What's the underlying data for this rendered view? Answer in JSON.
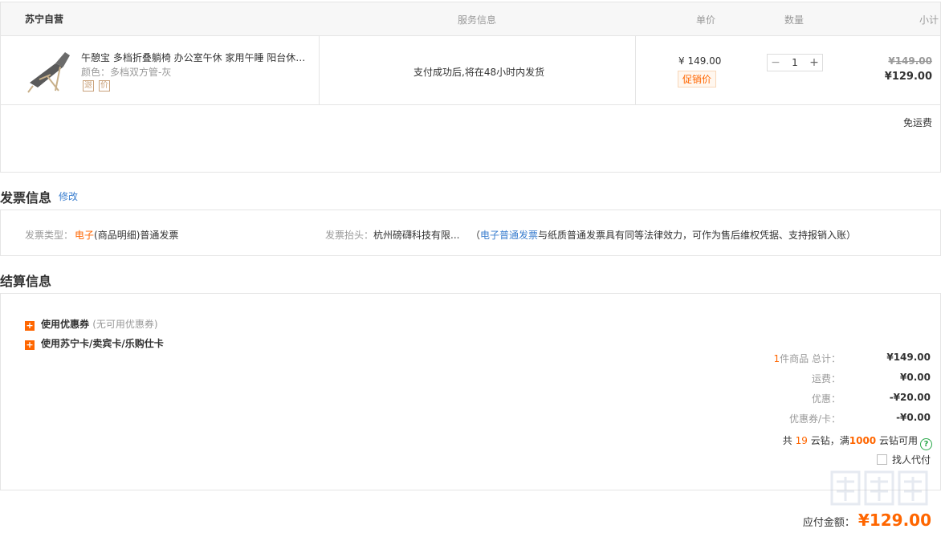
{
  "order": {
    "store_name": "苏宁自营",
    "headers": {
      "service": "服务信息",
      "price": "单价",
      "qty": "数量",
      "subtotal": "小计"
    },
    "item": {
      "title": "午憩宝 多档折叠躺椅 办公室午休 家用午睡 阳台休…",
      "color": "颜色：多档双方管-灰",
      "tags": [
        "退",
        "价"
      ],
      "service": "支付成功后,将在48小时内发货",
      "unit_price": "¥ 149.00",
      "promo_badge": "促销价",
      "qty_minus": "−",
      "qty_value": "1",
      "qty_plus": "+",
      "subtotal_old": "¥149.00",
      "subtotal_new": "¥129.00"
    },
    "shipping": "免运费"
  },
  "invoice": {
    "title": "发票信息",
    "edit_link": "修改",
    "type_label": "发票类型：",
    "type_value_highlight": "电子",
    "type_value_rest": "(商品明细)普通发票",
    "head_label": "发票抬头：",
    "head_value": "杭州磅礴科技有限...",
    "note_prefix": "（",
    "note_link": "电子普通发票",
    "note_rest": "与纸质普通发票具有同等法律效力，可作为售后维权凭据、支持报销入账）"
  },
  "settlement": {
    "title": "结算信息",
    "coupon_label": "使用优惠券",
    "coupon_hint": "(无可用优惠券)",
    "card_label": "使用苏宁卡/卖宾卡/乐购仕卡",
    "summary": {
      "count": "1",
      "count_suffix": "件商品 总计：",
      "total": "¥149.00",
      "freight_label": "运费：",
      "freight": "¥0.00",
      "discount_label": "优惠：",
      "discount": "-¥20.00",
      "coupon_card_label": "优惠券/卡：",
      "coupon_card": "-¥0.00"
    },
    "yunzuan": {
      "prefix": "共",
      "count": "19",
      "mid": "云钻，满",
      "threshold": "1000",
      "suffix": "云钻可用"
    },
    "proxy_pay_label": "找人代付"
  },
  "due": {
    "label": "应付金额：",
    "amount": "¥129.00"
  },
  "colors": {
    "accent": "#ff6600",
    "link": "#3a7ecf",
    "border": "#e5e5e5"
  },
  "icons": [
    "product-thumbnail",
    "return-tag-icon",
    "price-tag-icon",
    "plus-square-icon",
    "help-circle-icon",
    "checkbox"
  ]
}
